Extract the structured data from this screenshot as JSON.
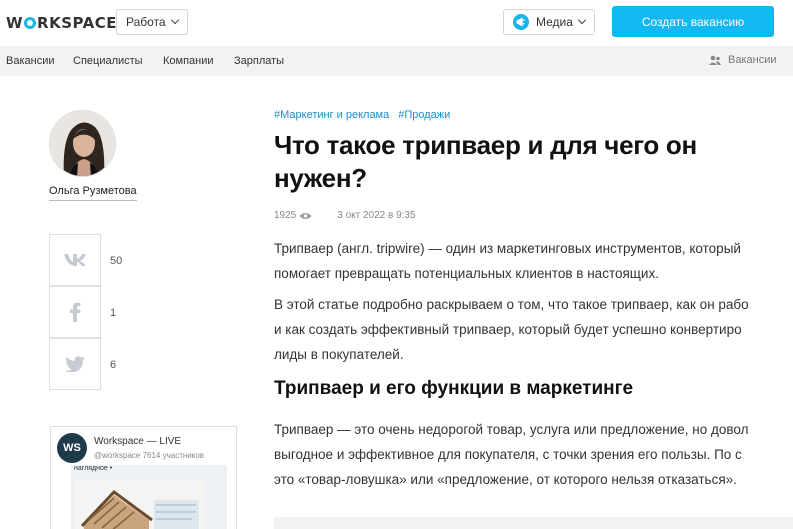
{
  "header": {
    "logo_left": "W",
    "logo_right": "RKSPACE",
    "work_label": "Работа",
    "media_label": "Медиа",
    "create_label": "Создать вакансию"
  },
  "nav": {
    "items": [
      "Вакансии",
      "Специалисты",
      "Компании",
      "Зарплаты"
    ],
    "right_label": "Вакансии"
  },
  "author": {
    "name": "Ольга Рузметова"
  },
  "share": [
    {
      "network": "vk-icon",
      "count": "50"
    },
    {
      "network": "facebook-icon",
      "count": "1"
    },
    {
      "network": "twitter-icon",
      "count": "6"
    }
  ],
  "widget": {
    "logo": "WS",
    "title": "Workspace — LIVE",
    "subtitle": "@workspace 7614 участников",
    "post_caption": "наглядное •"
  },
  "article": {
    "tags": [
      "#Маркетинг и реклама",
      "#Продажи"
    ],
    "title_line1": "Что такое трипваер и для чего он",
    "title_line2": "нужен?",
    "views": "1925",
    "date": "3 окт 2022 в 9:35",
    "p1_l1": "Трипваер (англ. tripwire) — один из маркетинговых инструментов, который",
    "p1_l2": "помогает превращать потенциальных клиентов в настоящих.",
    "p2_l1": "В этой статье подробно раскрываем о том, что такое трипваер, как он рабо",
    "p2_l2": "и как создать эффективный трипваер, который будет успешно конвертиро",
    "p2_l3": "лиды в покупателей.",
    "h2": "Трипваер и его функции в маркетинге",
    "p3_l1": "Трипваер — это очень недорогой товар, услуга или предложение, но довол",
    "p3_l2": "выгодное и эффективное для покупателя, с точки зрения его пользы. По с",
    "p3_l3": "это «товар-ловушка» или «предложение, от которого нельзя отказаться»."
  },
  "colors": {
    "accent": "#13b8f1",
    "tag": "#1a8fc9",
    "nav_bg": "#f2f2f2"
  }
}
